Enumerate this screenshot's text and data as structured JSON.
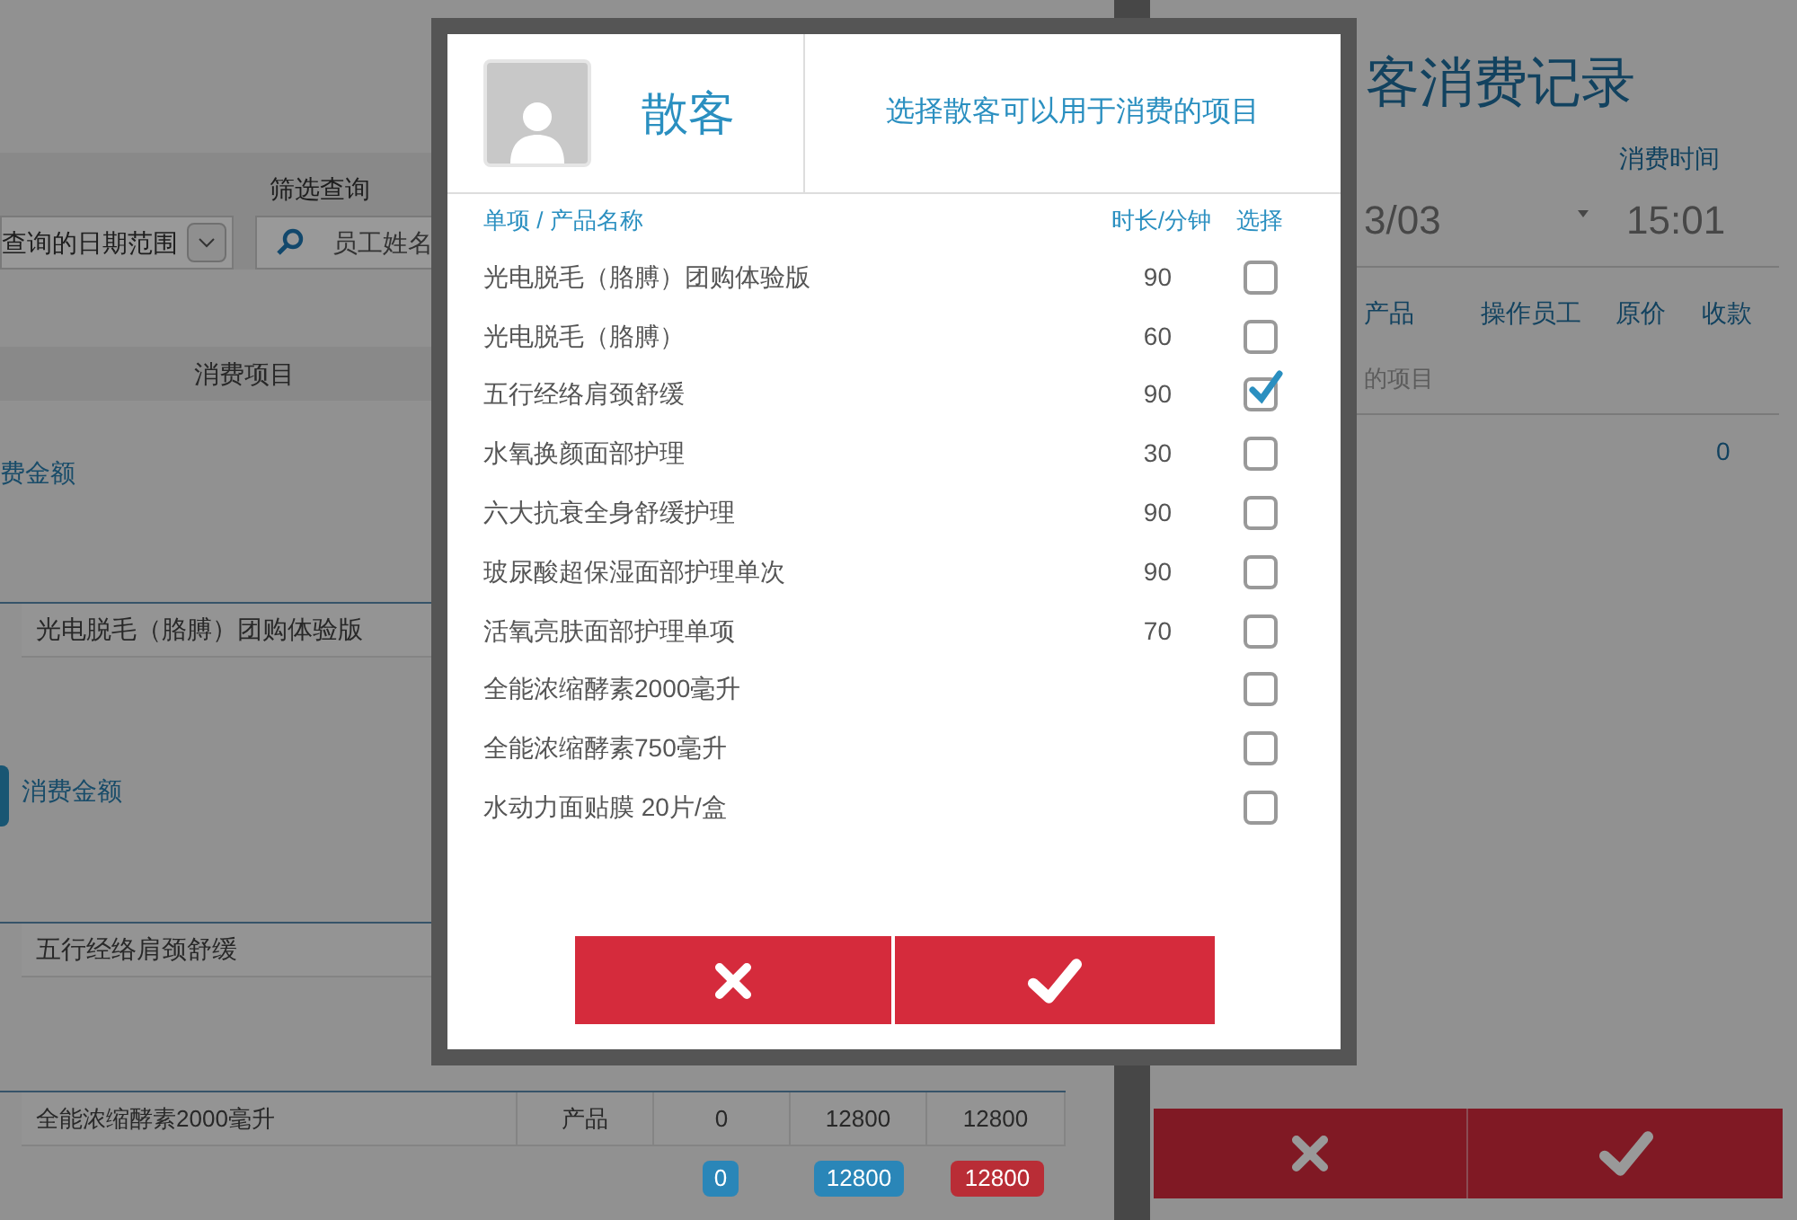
{
  "background": {
    "filter_label": "筛选查询",
    "date_range": "查询的日期范围",
    "employee_search": {
      "placeholder": "员工姓名"
    },
    "column_header": "消费项目",
    "sections": [
      {
        "label": "费金额",
        "tab": false,
        "item": "光电脱毛（胳膊）团购体验版"
      },
      {
        "label": "消费金额",
        "tab": true,
        "item": "五行经络肩颈舒缓"
      }
    ],
    "table_row": [
      "全能浓缩酵素2000毫升",
      "产品",
      "0",
      "12800",
      "12800"
    ],
    "badges": [
      {
        "text": "0",
        "color": "#2a86b8"
      },
      {
        "text": "12800",
        "color": "#2a86b8"
      },
      {
        "text": "12800",
        "color": "#b92d36"
      }
    ],
    "record": {
      "title": "客消费记录",
      "time_label": "消费时间",
      "date": "3/03",
      "time": "15:01",
      "columns": [
        "产品",
        "操作员工",
        "原价",
        "收款"
      ],
      "empty_text": "的项目",
      "total": "0"
    }
  },
  "dialog": {
    "customer": "散客",
    "hint": "选择散客可以用于消费的项目",
    "columns": [
      "单项 / 产品名称",
      "时长/分钟",
      "选择"
    ],
    "items": [
      {
        "name": "光电脱毛（胳膊）团购体验版",
        "minutes": "90",
        "checked": false
      },
      {
        "name": "光电脱毛（胳膊）",
        "minutes": "60",
        "checked": false
      },
      {
        "name": "五行经络肩颈舒缓",
        "minutes": "90",
        "checked": true
      },
      {
        "name": "水氧换颜面部护理",
        "minutes": "30",
        "checked": false
      },
      {
        "name": "六大抗衰全身舒缓护理",
        "minutes": "90",
        "checked": false
      },
      {
        "name": "玻尿酸超保湿面部护理单次",
        "minutes": "90",
        "checked": false
      },
      {
        "name": "活氧亮肤面部护理单项",
        "minutes": "70",
        "checked": false
      },
      {
        "name": "全能浓缩酵素2000毫升",
        "checked": false
      },
      {
        "name": "全能浓缩酵素750毫升",
        "checked": false
      },
      {
        "name": "水动力面贴膜 20片/盒",
        "checked": false
      }
    ]
  }
}
